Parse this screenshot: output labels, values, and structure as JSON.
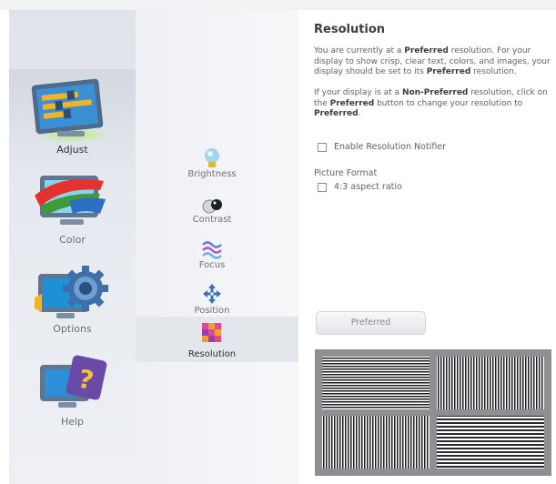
{
  "categories": [
    {
      "label": "Adjust",
      "icon": "adjust-monitor-icon",
      "selected": true
    },
    {
      "label": "Color",
      "icon": "color-monitor-icon",
      "selected": false
    },
    {
      "label": "Options",
      "icon": "options-gear-icon",
      "selected": false
    },
    {
      "label": "Help",
      "icon": "help-monitor-icon",
      "selected": false
    }
  ],
  "sub_items": [
    {
      "label": "Brightness",
      "icon": "lightbulb-icon",
      "selected": false
    },
    {
      "label": "Contrast",
      "icon": "contrast-icon",
      "selected": false
    },
    {
      "label": "Focus",
      "icon": "focus-waves-icon",
      "selected": false
    },
    {
      "label": "Position",
      "icon": "position-arrows-icon",
      "selected": false
    },
    {
      "label": "Resolution",
      "icon": "resolution-grid-icon",
      "selected": true
    }
  ],
  "content": {
    "title": "Resolution",
    "p1": {
      "a": "You are currently at a ",
      "b": "Preferred",
      "c": " resolution. For your display to show crisp, clear text, colors, and images, your display should be set to its ",
      "d": "Preferred",
      "e": " resolution."
    },
    "p2": {
      "a": "If your display is at a ",
      "b": "Non-Preferred",
      "c": " resolution, click on the ",
      "d": "Preferred",
      "e": " button to change your resolution to ",
      "f": "Preferred",
      "g": "."
    },
    "notifier_label": "Enable Resolution Notifier",
    "notifier_checked": false,
    "picture_format_label": "Picture Format",
    "aspect_label": "4:3 aspect ratio",
    "aspect_checked": false,
    "preferred_button": "Preferred"
  },
  "colors": {
    "selected_bg": "#d6dbe3",
    "pattern_bg": "#8d8f92"
  }
}
